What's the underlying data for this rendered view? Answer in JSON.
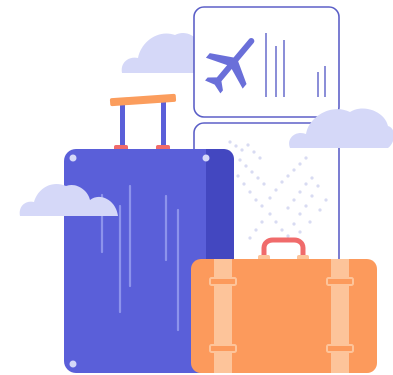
{
  "illustration": {
    "subject": "travel-luggage",
    "colors": {
      "suitcase_blue": "#5a5fd9",
      "suitcase_blue_dark": "#4347c0",
      "suitcase_stripe": "#8d93ec",
      "suitcase_orange": "#fc9a5c",
      "suitcase_orange_strap": "#fdc49a",
      "handle_orange": "#fb9d5d",
      "handle_red": "#f06b6b",
      "cloud": "#d5d8f8",
      "ticket_border": "#5b5fc7",
      "plane": "#6a6fd9",
      "map_dots": "#d8dbf2"
    },
    "icons": [
      "airplane-icon",
      "cloud-icon",
      "suitcase-icon",
      "ticket-icon"
    ]
  }
}
